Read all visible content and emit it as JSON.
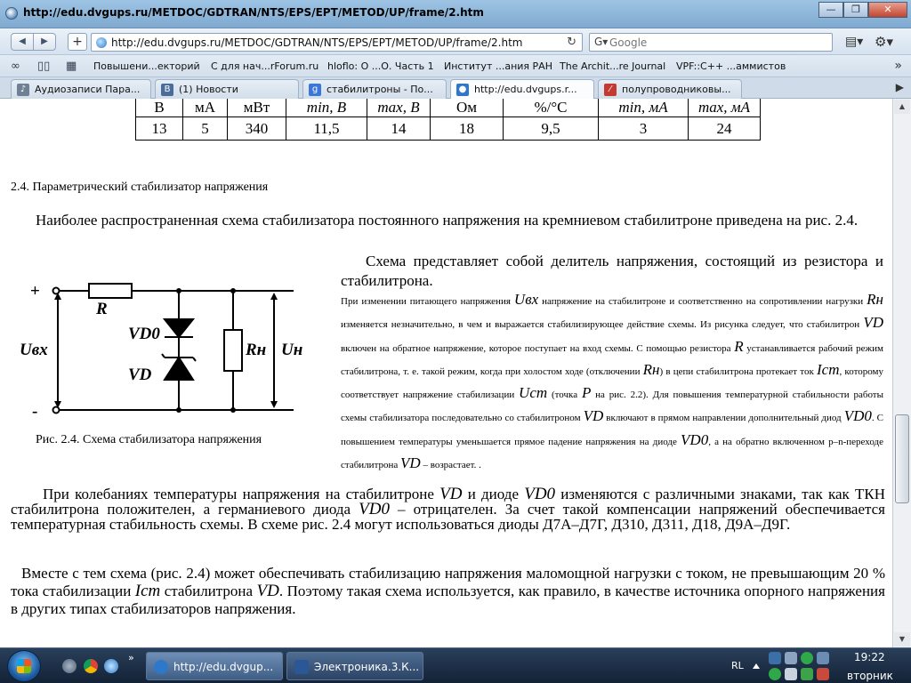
{
  "window": {
    "title": "http://edu.dvgups.ru/METDOC/GDTRAN/NTS/EPS/EPT/METOD/UP/frame/2.htm",
    "minimize": "—",
    "maximize": "❐",
    "close": "✕"
  },
  "nav": {
    "back": "◀",
    "forward": "▶",
    "new_tab": "+",
    "url": "http://edu.dvgups.ru/METDOC/GDTRAN/NTS/EPS/EPT/METOD/UP/frame/2.htm",
    "reload": "↻",
    "search_placeholder": "Google",
    "page_menu": "▤▾",
    "tools_menu": "⚙▾"
  },
  "bookmarks": [
    "Повышени...екторий",
    "С для нач...rForum.ru",
    "hloflo: О ...О. Часть 1",
    "Институт ...ания РАН",
    "The Archit...re Journal",
    "VPF::C++ ...аммистов"
  ],
  "bookmarks_more": "»",
  "tabs": [
    {
      "label": "Аудиозаписи Пара...",
      "icon": "♪",
      "color": "#6f7f94"
    },
    {
      "label": "(1) Новости",
      "icon": "В",
      "color": "#4a6e9c"
    },
    {
      "label": "стабилитроны - По...",
      "icon": "g",
      "color": "#3a77d8"
    },
    {
      "label": "http://edu.dvgups.r...",
      "icon": "●",
      "color": "#2d78c8"
    },
    {
      "label": "полупроводниковы...",
      "icon": "⁄",
      "color": "#c43a30"
    }
  ],
  "tabs_arrow": "▶",
  "table": {
    "units": [
      "В",
      "мА",
      "мВт",
      "min, В",
      "max, В",
      "Ом",
      "%/°С",
      "min, мА",
      "max, мА"
    ],
    "values": [
      "13",
      "5",
      "340",
      "11,5",
      "14",
      "18",
      "9,5",
      "3",
      "24"
    ]
  },
  "section_title": "2.4. Параметрический стабилизатор напряжения",
  "para1": "Наиболее распространенная схема стабилизатора постоянного напряжения на кремниевом стабилитроне приведена на рис. 2.4.",
  "figure": {
    "plus": "+",
    "minus": "-",
    "label_r": "R",
    "label_uin": "Uвх",
    "label_vd0": "VD0",
    "label_vd": "VD",
    "label_rn": "Rн",
    "label_un": "Uн",
    "caption": "Рис. 2.4. Схема стабилизатора напряжения"
  },
  "right_text": {
    "big": "Схема представляет собой делитель напряжения, состоящий из резистора  и стабилитрона.",
    "small_1": " При изменении питающего напряжения ",
    "var_uin": "Uвх",
    "small_2": " напряжение на стабилитроне и соответственно на сопротивлении нагрузки ",
    "var_rn": "Rн",
    "small_3": " изменяется незначительно, в чем и выражается стабилизирующее действие схемы. Из рисунка следует, что стабилитрон ",
    "var_vd": "VD",
    "small_4": " включен на обратное напряжение, которое поступает на вход схемы. С помощью резистора ",
    "var_r": "R",
    "small_5": "  устанавливается рабочий режим стабилитрона, т. е. такой режим, когда при хо­лостом ходе (отключении ",
    "var_rn2": "Rн",
    "small_6": ") в цепи стабилитрона протекает ток ",
    "var_ist": "Iст",
    "small_7": ", которому соответствует напряжение стабилизации ",
    "var_ust": "Uст",
    "small_8": " (точка ",
    "var_p": "P",
    "small_9": " на рис. 2.2). Для повышения температурной стабильности работы схемы стабилизатора последовательно со стабилитроном ",
    "var_vd2": "VD",
    "small_10": " включают в прямом направлении  дополнительный диод ",
    "var_vd0": "VD0",
    "small_11": ". С повышением температуры уменьшается прямое падение напряжения на диоде ",
    "var_vd0b": "VD0",
    "small_12": ", а на обратно включенном p–n-переходе стабилитрона ",
    "var_vd3": "VD",
    "small_13": " – возрастает.  ."
  },
  "para3": {
    "t1": "При колебаниях температуры напряжения на стабилитроне ",
    "v1": "VD",
    "t2": " и диоде ",
    "v2": "VD0",
    "t3": " изменяются с различными знаками, так как ТКН стабилитрона положителен, а германиевого диода ",
    "v3": "VD0",
    "t4": " – отрицателен. За счет такой компенсации напряжений обеспечивается температурная стабильность схемы. В схеме рис. 2.4 могут использоваться диоды Д7А–Д7Г, Д310, Д311, Д18, Д9А–Д9Г."
  },
  "para4": {
    "t1": "Вместе с тем схема (рис. 2.4) может обеспечивать стабилизацию напряжения маломощной нагрузки с током, не превышающим 20 % тока стабилизации ",
    "v1": "Iст",
    "t2": " стабилитрона ",
    "v2": "VD",
    "t3": ". Поэтому такая схема используется, как правило, в качестве источника опорного напряжения в других типах стабилизаторов напряжения."
  },
  "taskbar": {
    "quick_more": "»",
    "tasks": [
      {
        "label": "http://edu.dvgup...",
        "color": "#2d78c8"
      },
      {
        "label": "Электроника.3.К...",
        "color": "#2b5797"
      }
    ],
    "lang": "RL",
    "time": "19:22",
    "day": "вторник"
  }
}
